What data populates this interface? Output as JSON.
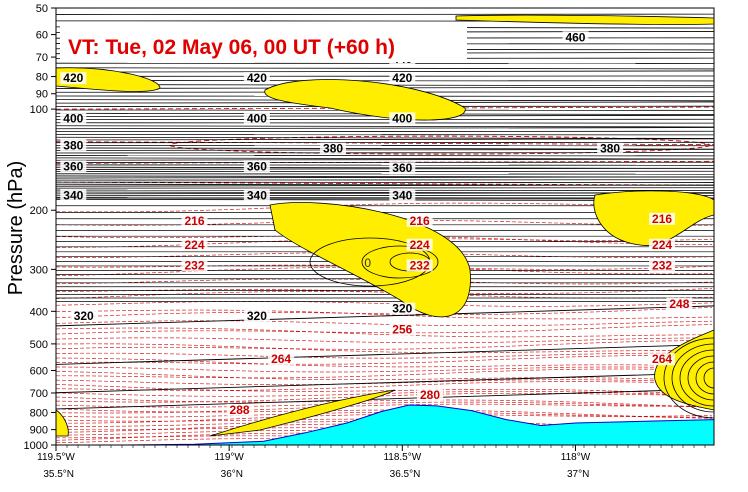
{
  "chart_data": {
    "type": "contour-cross-section",
    "title": "VT:  Tue, 02 May 06, 00 UT (+60 h)",
    "ylabel": "Pressure (hPa)",
    "yscale": "log",
    "ylim": [
      1000,
      50
    ],
    "y_ticks": [
      50,
      60,
      70,
      80,
      90,
      100,
      200,
      300,
      400,
      500,
      600,
      700,
      800,
      900,
      1000
    ],
    "x_ticks_lon": [
      "119.5°W",
      "119°W",
      "118.5°W",
      "118°W"
    ],
    "x_ticks_lat": [
      "35.5°N",
      "36°N",
      "36.5°N",
      "37°N"
    ],
    "x_tick_lon_values": [
      -119.5,
      -119.0,
      -118.5,
      -118.0
    ],
    "x_tick_lat_values": [
      35.5,
      36.0,
      36.5,
      37.0
    ],
    "xlim": [
      -119.5,
      -117.6
    ],
    "theta_labels": [
      {
        "text": "460",
        "lon": -118.0,
        "p": 62
      },
      {
        "text": "440",
        "lon": -118.5,
        "p": 72
      },
      {
        "text": "420",
        "lon": -119.45,
        "p": 82
      },
      {
        "text": "420",
        "lon": -118.92,
        "p": 82
      },
      {
        "text": "420",
        "lon": -118.5,
        "p": 82
      },
      {
        "text": "400",
        "lon": -119.45,
        "p": 108
      },
      {
        "text": "400",
        "lon": -118.92,
        "p": 108
      },
      {
        "text": "400",
        "lon": -118.5,
        "p": 108
      },
      {
        "text": "380",
        "lon": -119.45,
        "p": 130
      },
      {
        "text": "380",
        "lon": -118.7,
        "p": 133
      },
      {
        "text": "380",
        "lon": -117.9,
        "p": 133
      },
      {
        "text": "360",
        "lon": -119.45,
        "p": 150
      },
      {
        "text": "360",
        "lon": -118.92,
        "p": 150
      },
      {
        "text": "360",
        "lon": -118.5,
        "p": 152
      },
      {
        "text": "340",
        "lon": -119.45,
        "p": 183
      },
      {
        "text": "340",
        "lon": -118.92,
        "p": 183
      },
      {
        "text": "340",
        "lon": -118.5,
        "p": 183
      },
      {
        "text": "320",
        "lon": -119.42,
        "p": 418
      },
      {
        "text": "320",
        "lon": -118.92,
        "p": 418
      },
      {
        "text": "320",
        "lon": -118.5,
        "p": 398
      }
    ],
    "temp_labels": [
      {
        "text": "216",
        "lon": -119.1,
        "p": 218
      },
      {
        "text": "216",
        "lon": -118.45,
        "p": 218
      },
      {
        "text": "216",
        "lon": -117.75,
        "p": 215
      },
      {
        "text": "224",
        "lon": -119.1,
        "p": 257
      },
      {
        "text": "224",
        "lon": -118.45,
        "p": 257
      },
      {
        "text": "224",
        "lon": -117.75,
        "p": 257
      },
      {
        "text": "232",
        "lon": -119.1,
        "p": 296
      },
      {
        "text": "232",
        "lon": -118.45,
        "p": 296
      },
      {
        "text": "232",
        "lon": -117.75,
        "p": 296
      },
      {
        "text": "248",
        "lon": -117.7,
        "p": 385
      },
      {
        "text": "256",
        "lon": -118.5,
        "p": 460
      },
      {
        "text": "264",
        "lon": -118.85,
        "p": 563
      },
      {
        "text": "264",
        "lon": -117.75,
        "p": 563
      },
      {
        "text": "280",
        "lon": -118.42,
        "p": 720
      },
      {
        "text": "288",
        "lon": -118.97,
        "p": 797
      }
    ],
    "pv_labels": [
      {
        "text": "0",
        "lon": -118.6,
        "p": 287
      }
    ],
    "terrain": {
      "lon": [
        -119.5,
        -119.3,
        -119.1,
        -118.9,
        -118.78,
        -118.66,
        -118.56,
        -118.48,
        -118.4,
        -118.3,
        -118.2,
        -118.1,
        -118.0,
        -117.8,
        -117.6
      ],
      "p": [
        1000,
        1000,
        995,
        975,
        920,
        860,
        795,
        760,
        765,
        790,
        840,
        875,
        860,
        850,
        840
      ]
    },
    "colors": {
      "terrain": "#00ffff",
      "shading": "#ffee00",
      "theta": "#000000",
      "temperature": "#cc0000",
      "title": "#e00000"
    }
  }
}
